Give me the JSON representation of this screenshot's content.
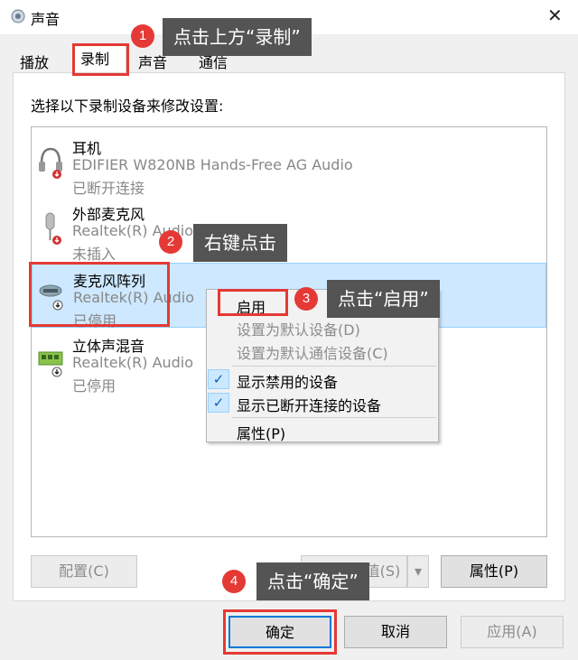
{
  "window": {
    "title": "声音",
    "close": "✕"
  },
  "tabs": [
    {
      "label": "播放"
    },
    {
      "label": "录制"
    },
    {
      "label": "声音"
    },
    {
      "label": "通信"
    }
  ],
  "instruction": "选择以下录制设备来修改设置:",
  "devices": [
    {
      "name": "耳机",
      "driver": "EDIFIER W820NB Hands-Free AG Audio",
      "status": "已断开连接",
      "icon": "headset-icon"
    },
    {
      "name": "外部麦克风",
      "driver": "Realtek(R) Audio",
      "status": "未插入",
      "icon": "microphone-icon"
    },
    {
      "name": "麦克风阵列",
      "driver": "Realtek(R) Audio",
      "status": "已停用",
      "icon": "microphone-array-icon"
    },
    {
      "name": "立体声混音",
      "driver": "Realtek(R) Audio",
      "status": "已停用",
      "icon": "sound-card-icon"
    }
  ],
  "context_menu": {
    "enable": "启用",
    "set_default": "设置为默认设备(D)",
    "set_default_comm": "设置为默认通信设备(C)",
    "show_disabled": "显示禁用的设备",
    "show_disconnected": "显示已断开连接的设备",
    "properties": "属性(P)",
    "check": "✓"
  },
  "buttons": {
    "configure": "配置(C)",
    "set_default": "设为默认值(S)",
    "split_arrow": "▾",
    "properties": "属性(P)",
    "ok": "确定",
    "cancel": "取消",
    "apply": "应用(A)"
  },
  "annotations": [
    {
      "num": "1",
      "text": "点击上方“录制”"
    },
    {
      "num": "2",
      "text": "右键点击"
    },
    {
      "num": "3",
      "text": "点击“启用”"
    },
    {
      "num": "4",
      "text": "点击“确定”"
    }
  ],
  "colors": {
    "highlight": "#e53935",
    "callout_bg": "#545454",
    "selection": "#cde8ff",
    "accent": "#0078d7"
  }
}
